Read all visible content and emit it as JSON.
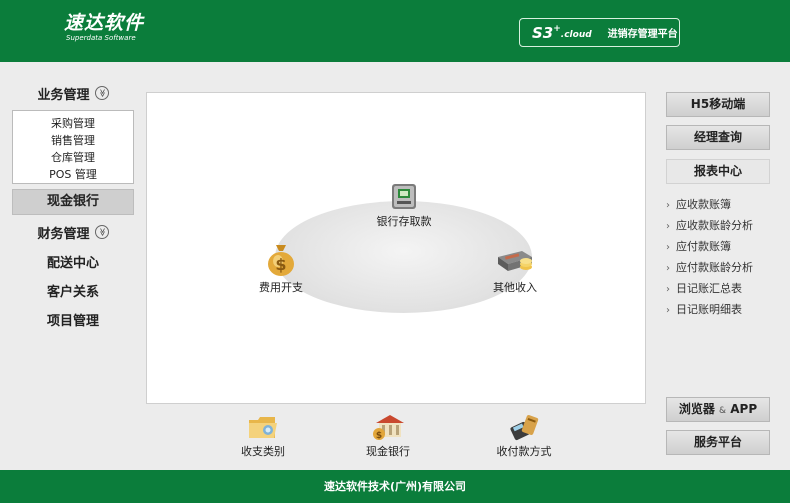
{
  "header": {
    "logo_cn": "速达软件",
    "logo_en": "Superdata Software",
    "product_s3": "S3",
    "product_plus": "+",
    "product_cloud": ".cloud",
    "product_name": "进销存管理平台"
  },
  "left_nav": {
    "business": "业务管理",
    "business_items": [
      "采购管理",
      "销售管理",
      "仓库管理",
      "POS 管理"
    ],
    "cash_bank": "现金银行",
    "finance": "财务管理",
    "delivery": "配送中心",
    "customer": "客户关系",
    "project": "项目管理",
    "chevron": "≫"
  },
  "main": {
    "atm_label": "银行存取款",
    "expense_label": "费用开支",
    "income_label": "其他收入"
  },
  "quick": {
    "category": "收支类别",
    "cash_bank": "现金银行",
    "payment_method": "收付款方式"
  },
  "right": {
    "h5": "H5移动端",
    "manager": "经理查询",
    "report_center": "报表中心",
    "reports": [
      "应收款账簿",
      "应收款账龄分析",
      "应付款账簿",
      "应付款账龄分析",
      "日记账汇总表",
      "日记账明细表"
    ],
    "browser_main": "浏览器",
    "browser_amp": "&",
    "browser_app": "APP",
    "service": "服务平台"
  },
  "footer": {
    "text": "速达软件技术(广州)有限公司"
  },
  "colors": {
    "brand_green": "#0b7d3b",
    "panel": "#ffffff",
    "background": "#ececec"
  }
}
